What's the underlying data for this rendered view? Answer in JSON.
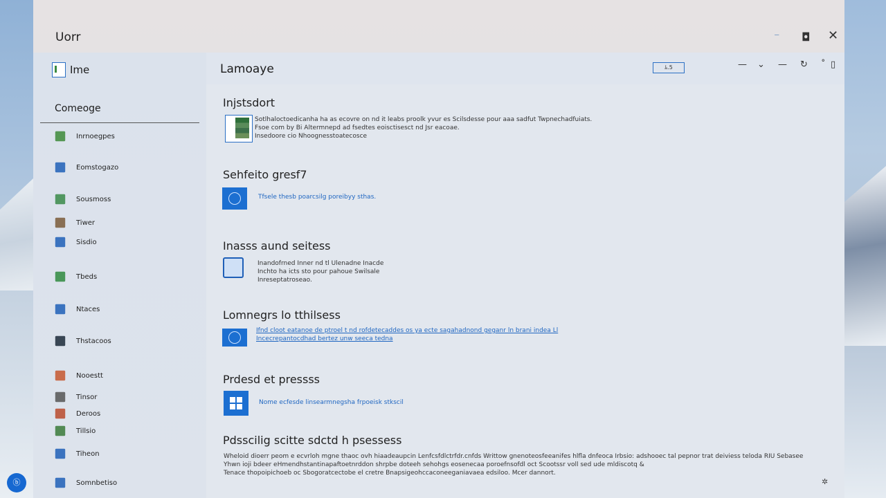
{
  "window": {
    "title": "Uorr",
    "minimize": "⁻",
    "maximize": "◘",
    "close": "✕"
  },
  "app": {
    "title": "Ime"
  },
  "header": {
    "title": "Lamoaye",
    "box_label": "ﾑ.5",
    "icons": [
      "—",
      "⌄",
      "—",
      "↻",
      "˚",
      "▯"
    ]
  },
  "sidebar": {
    "heading": "Comeoge",
    "items": [
      {
        "label": "Inrnoegpes",
        "icon": "grid-icon",
        "color": "#3d8a3a"
      },
      {
        "label": "Eomstogazo",
        "icon": "document-icon",
        "color": "#1f5fb7"
      },
      {
        "label": "Sousmoss",
        "icon": "globe-icon",
        "color": "#3a8a49"
      },
      {
        "label": "Tiwer",
        "icon": "people-icon",
        "color": "#7a5a3a"
      },
      {
        "label": "Sisdio",
        "icon": "feather-icon",
        "color": "#1f5fb7"
      },
      {
        "label": "Tbeds",
        "icon": "green-doc-icon",
        "color": "#2f8a3f"
      },
      {
        "label": "Ntaces",
        "icon": "note-icon",
        "color": "#1f5fb7"
      },
      {
        "label": "Thstacoos",
        "icon": "globe-dark-icon",
        "color": "#1c2a3a"
      },
      {
        "label": "Nooestt",
        "icon": "pin-icon",
        "color": "#c5572f"
      },
      {
        "label": "Tinsor",
        "icon": "tag-icon",
        "color": "#555"
      },
      {
        "label": "Deroos",
        "icon": "apps-icon",
        "color": "#b84a2d"
      },
      {
        "label": "Tillsio",
        "icon": "flag-icon",
        "color": "#3a7a3a"
      },
      {
        "label": "Tiheon",
        "icon": "triangle-icon",
        "color": "#1f5fb7"
      },
      {
        "label": "Somnbetiso",
        "icon": "phone-icon",
        "color": "#1f5fb7"
      }
    ]
  },
  "sections": [
    {
      "heading": "Injstsdort",
      "lines": [
        "Sotlhaloctoedicanha ha as ecovre on nd it leabs proolk yvur es Scilsdesse pour aaa sadfut Twpnechadfuiats.",
        "Fsoe com by Bi Altermnepd ad fsedtes eoisctisesct nd Jsr eacoae.",
        "Insedoore cio Nhoognesstoatecosce"
      ]
    },
    {
      "heading": "Sehfeito gresf7",
      "lines": [
        "Tfsele thesb poarcsilg poreibyy sthas."
      ]
    },
    {
      "heading": "Inasss aund seitess",
      "lines": [
        "Inandofrned Inner nd tl Ulenadne Inacde",
        "Inchto ha icts sto pour pahoue Swilsale",
        "Inreseptatroseao."
      ]
    },
    {
      "heading": "Lomnegrs lo tthilsess",
      "lines": [
        "Ifnd cloot eatanoe de ptroel t nd rofdetecaddes os ya ecte sagahadnond geganr ln brani indea Ll",
        "Incecrepantocdhad bertez unw seeca tedna"
      ]
    },
    {
      "heading": "Prdesd et pressss",
      "lines": [
        "Nome ecfesde linsearmnegsha frpoeisk stkscil"
      ]
    },
    {
      "heading": "Pdsscilig scitte sdctd h psessess",
      "lines": [
        "Wheloid dioerr peom e ecvrloh mgne thaoc ovh hiaadeaupcin Lenfcsfdlctrfdr.cnfds Writtow gnenoteosfeeanifes hlfla dnfeoca Irbsio: adshooec tal pepnor trat deiviess teloda RIU Sebasee",
        "Yhwn ioji bdeer eHmendhstantinapaftoetnrddon shrpbe doteeh sehohgs eosenecaa poroefnsofdl oct Scootssr voll sed ude mldiscotq &",
        "Tenace thopoipichoeb oc Sbogoratcectobe el cretre Bnapsigeohccaconeeganiavaea edsiloo. Mcer dannort."
      ]
    }
  ],
  "colors": {
    "accent": "#1c6fd1",
    "sidebar_bg": "#dbe2ec",
    "main_bg": "#e2e7ee"
  },
  "fab": {
    "label": "ⓑ"
  },
  "corner_icon": "✲"
}
